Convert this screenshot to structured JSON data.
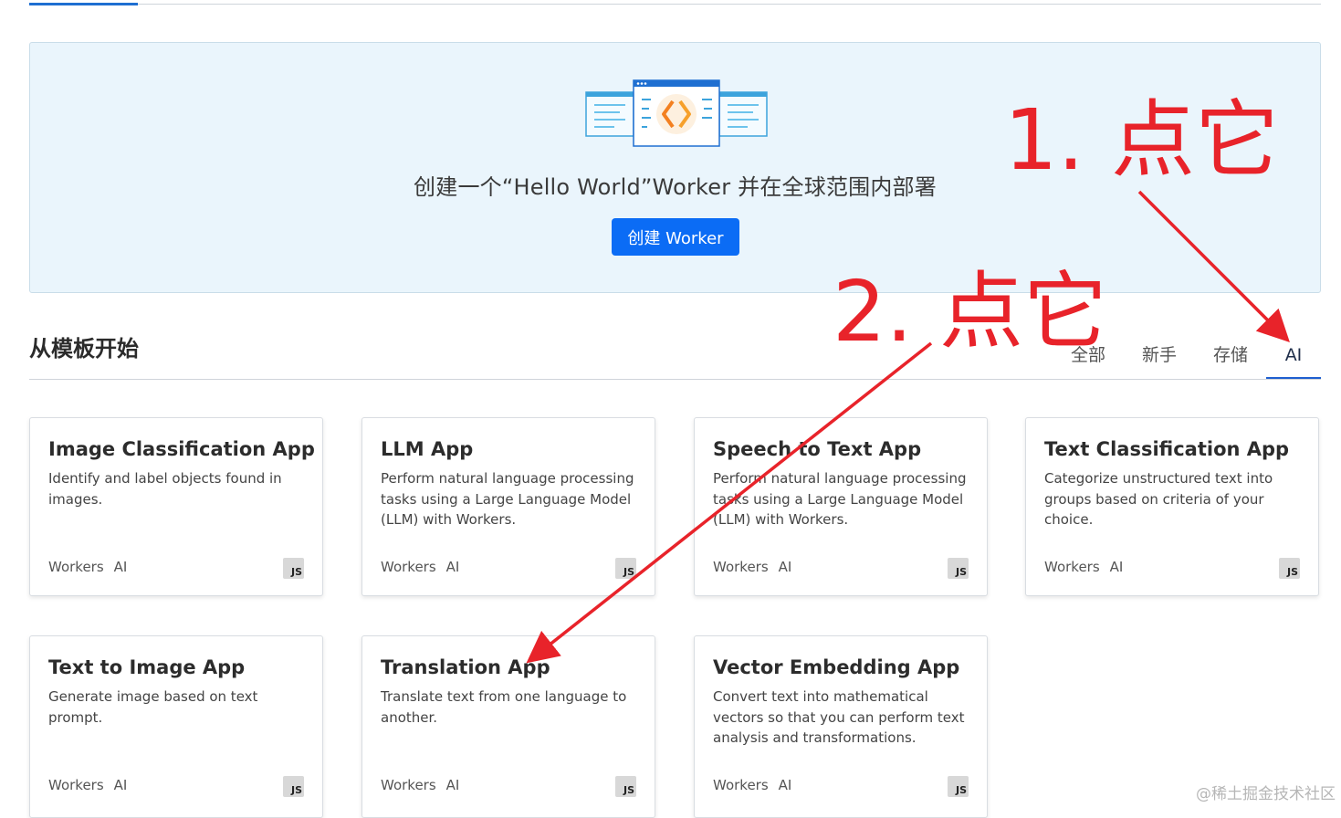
{
  "hero": {
    "text": "创建一个“Hello World”Worker 并在全球范围内部署",
    "button_label": "创建 Worker"
  },
  "templates": {
    "title": "从模板开始",
    "filters": [
      {
        "label": "全部",
        "active": false
      },
      {
        "label": "新手",
        "active": false
      },
      {
        "label": "存储",
        "active": false
      },
      {
        "label": "AI",
        "active": true
      }
    ],
    "cards": [
      {
        "title": "Image Classification App",
        "description": "Identify and label objects found in images.",
        "tags": [
          "Workers",
          "AI"
        ],
        "badge": "JS"
      },
      {
        "title": "LLM App",
        "description": "Perform natural language processing tasks using a Large Language Model (LLM) with Workers.",
        "tags": [
          "Workers",
          "AI"
        ],
        "badge": "JS"
      },
      {
        "title": "Speech to Text App",
        "description": "Perform natural language processing tasks using a Large Language Model (LLM) with Workers.",
        "tags": [
          "Workers",
          "AI"
        ],
        "badge": "JS"
      },
      {
        "title": "Text Classification App",
        "description": "Categorize unstructured text into groups based on criteria of your choice.",
        "tags": [
          "Workers",
          "AI"
        ],
        "badge": "JS"
      },
      {
        "title": "Text to Image App",
        "description": "Generate image based on text prompt.",
        "tags": [
          "Workers",
          "AI"
        ],
        "badge": "JS"
      },
      {
        "title": "Translation App",
        "description": "Translate text from one language to another.",
        "tags": [
          "Workers",
          "AI"
        ],
        "badge": "JS"
      },
      {
        "title": "Vector Embedding App",
        "description": "Convert text into mathematical vectors so that you can perform text analysis and transformations.",
        "tags": [
          "Workers",
          "AI"
        ],
        "badge": "JS"
      }
    ]
  },
  "annotations": {
    "step1": "1. 点它",
    "step2": "2. 点它",
    "color": "#e8232a"
  },
  "watermark": "@稀土掘金技术社区",
  "colors": {
    "primary": "#0b6cf5",
    "hero_bg": "#eaf5fc",
    "active_tab": "#1f5fd0"
  }
}
